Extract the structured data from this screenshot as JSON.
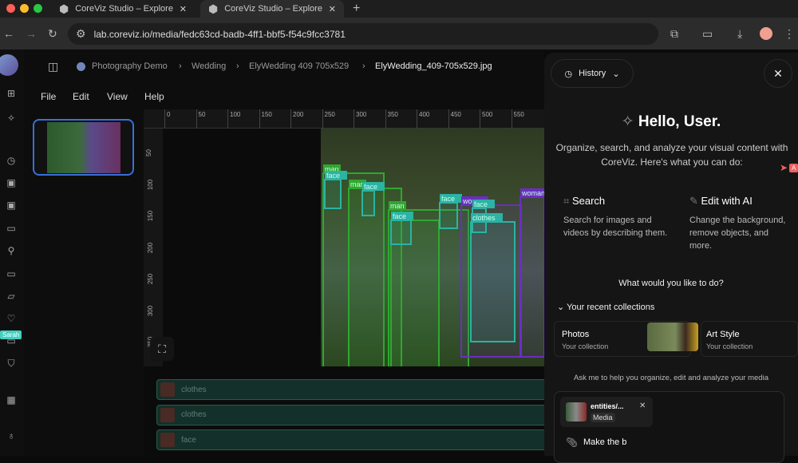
{
  "browser": {
    "tabs": [
      {
        "title": "CoreViz Studio – Explore, organize"
      },
      {
        "title": "CoreViz Studio – Explore, organize"
      }
    ],
    "url": "lab.coreviz.io/media/fedc63cd-badb-4ff1-bbf5-f54c9fcc3781"
  },
  "breadcrumb": [
    "Photography Demo",
    "Wedding",
    "ElyWedding 409 705x529",
    "ElyWedding_409-705x529.jpg"
  ],
  "menu": [
    "File",
    "Edit",
    "View",
    "Help"
  ],
  "rail": {
    "cursor_label": "Sarah",
    "icons": [
      "folder-plus-icon",
      "sparkle-icon",
      "folder-clock-icon",
      "image-icon",
      "image-icon",
      "video-icon",
      "bicycle-icon",
      "video-icon",
      "folder-icon",
      "heart-icon",
      "video-icon",
      "shirt-icon",
      "building-icon",
      "lightbulb-icon"
    ]
  },
  "ruler": {
    "top": [
      "0",
      "50",
      "100",
      "150",
      "200",
      "250",
      "300",
      "350",
      "400",
      "450",
      "500",
      "550"
    ],
    "left": [
      "50",
      "100",
      "150",
      "200",
      "250",
      "300",
      "350"
    ]
  },
  "detections": [
    "man",
    "face",
    "man",
    "face",
    "man",
    "man",
    "face",
    "face",
    "woman",
    "face",
    "woman",
    "clothes"
  ],
  "layers": [
    {
      "label": "clothes"
    },
    {
      "label": "clothes"
    },
    {
      "label": "face"
    }
  ],
  "panel": {
    "history": "History",
    "greeting": "Hello, User.",
    "intro": "Organize, search, and analyze your visual content with CoreViz. Here's what you can do:",
    "features": [
      {
        "title": "Search",
        "desc": "Search for images and videos by describing them."
      },
      {
        "title": "Edit with AI",
        "desc": "Change the background, remove objects, and more."
      }
    ],
    "question": "What would you like to do?",
    "recent": "Your recent collections",
    "collections": [
      {
        "name": "Photos",
        "sub": "Your collection"
      },
      {
        "name": "Art Style",
        "sub": "Your collection"
      }
    ],
    "hint": "Ask me to help you organize, edit and analyze your media",
    "attachment": {
      "name": "entities/...",
      "type": "Media"
    },
    "input": "Make the b",
    "cursor_label": "A"
  },
  "colors": {
    "accent": "#3a6fd8",
    "man": "#2fa82f",
    "face": "#2bb3a3",
    "woman": "#6a2fc0",
    "layer": "#13302a"
  }
}
